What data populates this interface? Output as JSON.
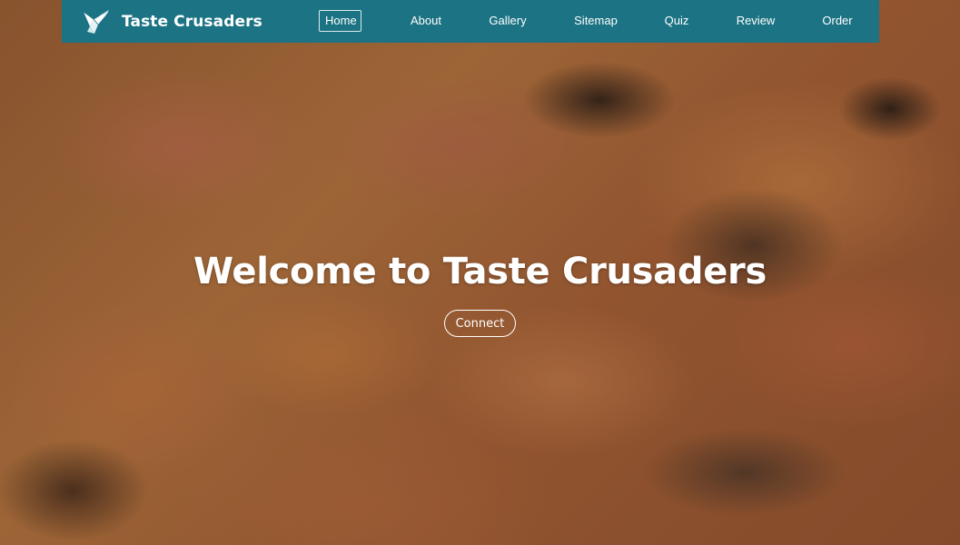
{
  "brand": {
    "name": "Taste Crusaders",
    "logo_icon": "origami-bird-icon"
  },
  "nav": {
    "items": [
      {
        "label": "Home",
        "active": true
      },
      {
        "label": "About",
        "active": false
      },
      {
        "label": "Gallery",
        "active": false
      },
      {
        "label": "Sitemap",
        "active": false
      },
      {
        "label": "Quiz",
        "active": false
      },
      {
        "label": "Review",
        "active": false
      },
      {
        "label": "Order",
        "active": false
      }
    ]
  },
  "hero": {
    "title": "Welcome to Taste Crusaders",
    "button_label": "Connect",
    "background": "pizza-closeup-photo"
  },
  "colors": {
    "navbar": "#1b7383",
    "text": "#ffffff"
  }
}
